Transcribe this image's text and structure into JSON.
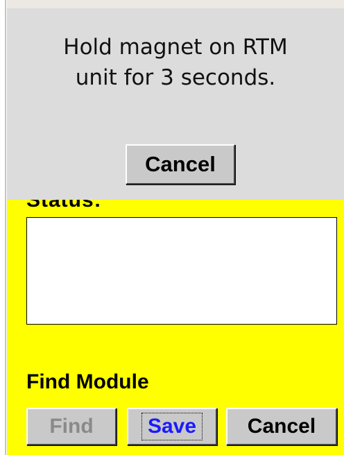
{
  "overlay": {
    "message": "Hold magnet on RTM\nunit for 3 seconds.",
    "cancel_label": "Cancel"
  },
  "main": {
    "status_label": "Status:",
    "status_text": "",
    "find_module_label": "Find Module",
    "buttons": {
      "find_label": "Find",
      "save_label": "Save",
      "cancel_label": "Cancel"
    }
  },
  "colors": {
    "panel_background": "#ffff00",
    "overlay_background": "#dcdcdc",
    "button_face": "#c9c9c9",
    "disabled_text": "#8a8a8a",
    "focus_text": "#1a1aff"
  }
}
